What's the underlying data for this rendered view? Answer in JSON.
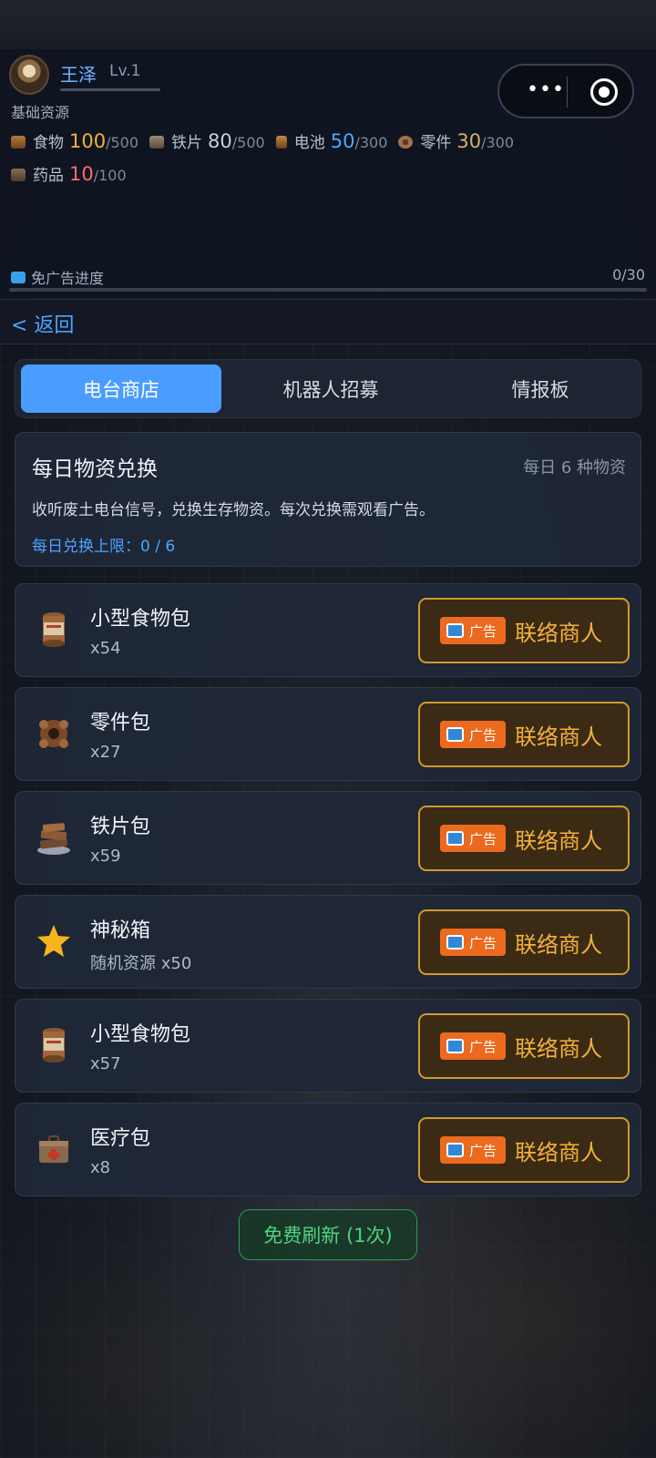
{
  "header": {
    "username": "王泽",
    "level": "Lv.1",
    "resources_title": "基础资源",
    "resources": [
      {
        "icon": "food-can-icon",
        "name": "食物",
        "value": "100",
        "max": "/500",
        "value_color": "#f0b23a"
      },
      {
        "icon": "iron-plate-icon",
        "name": "铁片",
        "value": "80",
        "max": "/500",
        "value_color": "#c9ced8"
      },
      {
        "icon": "battery-icon",
        "name": "电池",
        "value": "50",
        "max": "/300",
        "value_color": "#4aa8ff"
      },
      {
        "icon": "gear-parts-icon",
        "name": "零件",
        "value": "30",
        "max": "/300",
        "value_color": "#d6b072"
      },
      {
        "icon": "medicine-box-icon",
        "name": "药品",
        "value": "10",
        "max": "/100",
        "value_color": "#ff6b6b"
      }
    ],
    "ad_progress_label": "免广告进度",
    "ad_progress_count": "0/30",
    "ad_progress_fraction": 0
  },
  "nav": {
    "back_label": "< 返回"
  },
  "tabs": [
    {
      "label": "电台商店",
      "active": true
    },
    {
      "label": "机器人招募",
      "active": false
    },
    {
      "label": "情报板",
      "active": false
    }
  ],
  "info": {
    "title": "每日物资兑换",
    "side_note": "每日 6 种物资",
    "description": "收听废土电台信号，兑换生存物资。每次兑换需观看广告。",
    "limit": "每日兑换上限：0 / 6"
  },
  "items": [
    {
      "name": "小型食物包",
      "qty": "x54",
      "icon": "food-can-icon"
    },
    {
      "name": "零件包",
      "qty": "x27",
      "icon": "gear-parts-icon"
    },
    {
      "name": "铁片包",
      "qty": "x59",
      "icon": "iron-plate-icon"
    },
    {
      "name": "神秘箱",
      "qty": "随机资源 x50",
      "icon": "star-icon"
    },
    {
      "name": "小型食物包",
      "qty": "x57",
      "icon": "food-can-icon"
    },
    {
      "name": "医疗包",
      "qty": "x8",
      "icon": "medicine-box-icon"
    }
  ],
  "contact_button": {
    "ad_label": "广告",
    "label": "联络商人"
  },
  "refresh_button": {
    "label": "免费刷新 (1次)"
  },
  "colors": {
    "accent": "#4a9dff",
    "gold": "#f2b13b",
    "ad_orange": "#ec6a1e",
    "green": "#4fd47e"
  }
}
